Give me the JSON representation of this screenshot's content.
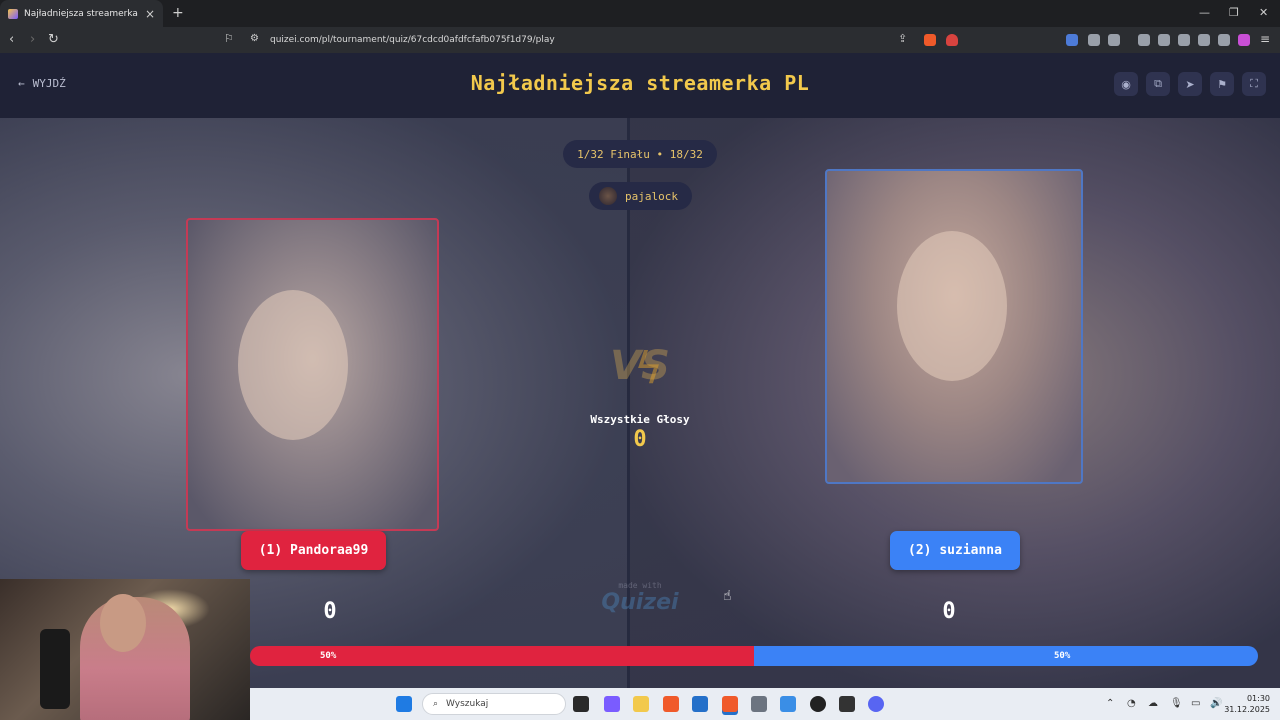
{
  "browser": {
    "tab_title": "Najładniejsza streamerka PL - Li",
    "url": "quizei.com/pl/tournament/quiz/67cdcd0afdfcfafb075f1d79/play"
  },
  "header": {
    "back_label": "WYJDŹ",
    "title": "Najładniejsza streamerka PL"
  },
  "match": {
    "round": "1/32 Finału • 18/32",
    "user": "pajalock",
    "all_votes_label": "Wszystkie Głosy",
    "all_votes_value": "0",
    "vs": "VS"
  },
  "left": {
    "button": "(1) Pandoraa99",
    "count": "0",
    "percent_label": "50%",
    "share": 0.5,
    "color": "#e0233f"
  },
  "right": {
    "button": "(2) suzianna",
    "count": "0",
    "percent_label": "50%",
    "share": 0.5,
    "color": "#3b82f6"
  },
  "watermark": {
    "made_with": "made with",
    "brand": "Quizei"
  },
  "taskbar": {
    "search_placeholder": "Wyszukaj",
    "time": "01:30",
    "date": "31.12.2025"
  }
}
